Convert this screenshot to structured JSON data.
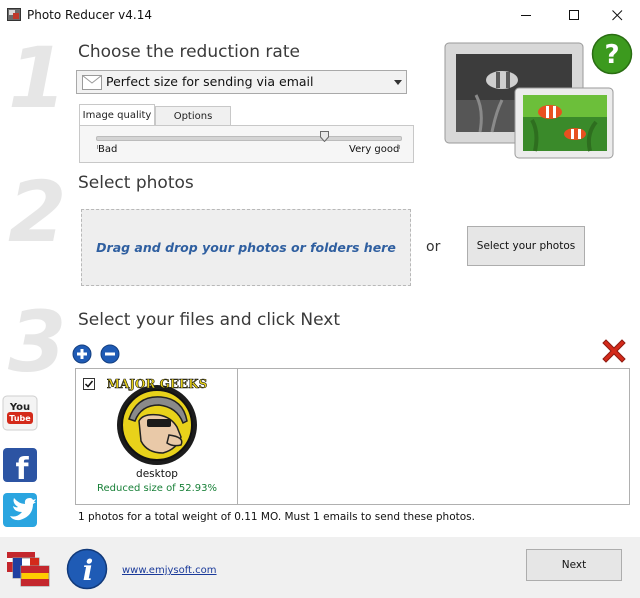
{
  "window": {
    "title": "Photo Reducer v4.14"
  },
  "steps": {
    "step1": {
      "number": "1",
      "heading": "Choose the reduction rate",
      "preset_select": {
        "value": "Perfect size for sending via email",
        "icon": "envelope-icon"
      },
      "tabs": [
        {
          "label": "Image quality",
          "active": true
        },
        {
          "label": "Options",
          "active": false
        }
      ],
      "quality_slider": {
        "min_label": "Bad",
        "max_label": "Very good",
        "level": 0.75
      }
    },
    "step2": {
      "number": "2",
      "heading": "Select photos",
      "dropzone_text": "Drag and drop your photos or folders here",
      "or_text": "or",
      "select_button": {
        "label": "Select your photos",
        "accelerator": "S"
      }
    },
    "step3": {
      "number": "3",
      "heading": "Select your files and click Next",
      "files": [
        {
          "checked": true,
          "name": "desktop",
          "reduction": "Reduced size of 52.93%",
          "logo_text": "MAJOR GEEKS"
        }
      ],
      "summary": "1 photos for a total weight of 0.11 MO. Must 1 emails to send these photos."
    }
  },
  "footer": {
    "website_link": "www.emjysoft.com",
    "next_label": "Next"
  },
  "icons": {
    "add": "plus-circle-icon",
    "remove": "minus-circle-icon",
    "delete": "red-x-icon",
    "help": "question-mark-icon",
    "info": "info-icon",
    "youtube": "youtube-icon",
    "facebook": "facebook-icon",
    "twitter": "twitter-icon",
    "flags": "language-flags-icon"
  },
  "colors": {
    "accent_blue": "#2f5fa0",
    "reduction_green": "#188038",
    "help_green": "#3c9a1e",
    "delete_red": "#d42a1a"
  }
}
